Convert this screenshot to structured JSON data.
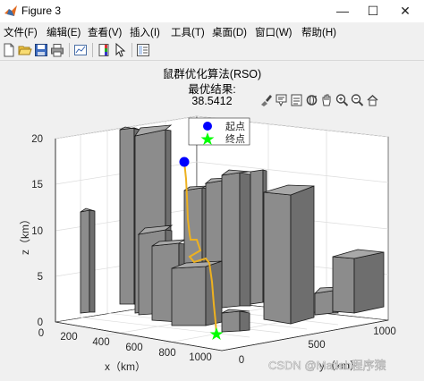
{
  "window": {
    "title": "Figure 3"
  },
  "menu": [
    "文件(F)",
    "编辑(E)",
    "查看(V)",
    "插入(I)",
    "工具(T)",
    "桌面(D)",
    "窗口(W)",
    "帮助(H)"
  ],
  "toolbar": [
    "new-figure-icon",
    "open-icon",
    "save-icon",
    "print-icon",
    "link-plot-icon",
    "colorbar-icon",
    "pointer-icon",
    "property-inspector-icon"
  ],
  "axes_toolbar": [
    "brush-icon",
    "data-tips-icon",
    "save-axes-icon",
    "rotate-3d-icon",
    "pan-icon",
    "zoom-in-icon",
    "zoom-out-icon",
    "home-icon"
  ],
  "plot": {
    "title_line1": "鼠群优化算法(RSO)",
    "title_line2": "最优结果:",
    "title_line3": "38.5412",
    "zlabel": "z（km）",
    "xlabel": "x（km）",
    "ylabel": "y（km）",
    "z_ticks": [
      "0",
      "5",
      "10",
      "15",
      "20"
    ],
    "x_ticks": [
      "0",
      "200",
      "400",
      "600",
      "800",
      "1000"
    ],
    "y_ticks": [
      "0",
      "500",
      "1000"
    ],
    "legend": [
      "起点",
      "终点"
    ]
  },
  "colors": {
    "building": "#8c8c8c",
    "path": "#edb120",
    "start": "#0000ff",
    "end": "#00ff00"
  },
  "watermark": "CSDN @Matlab程序猿"
}
